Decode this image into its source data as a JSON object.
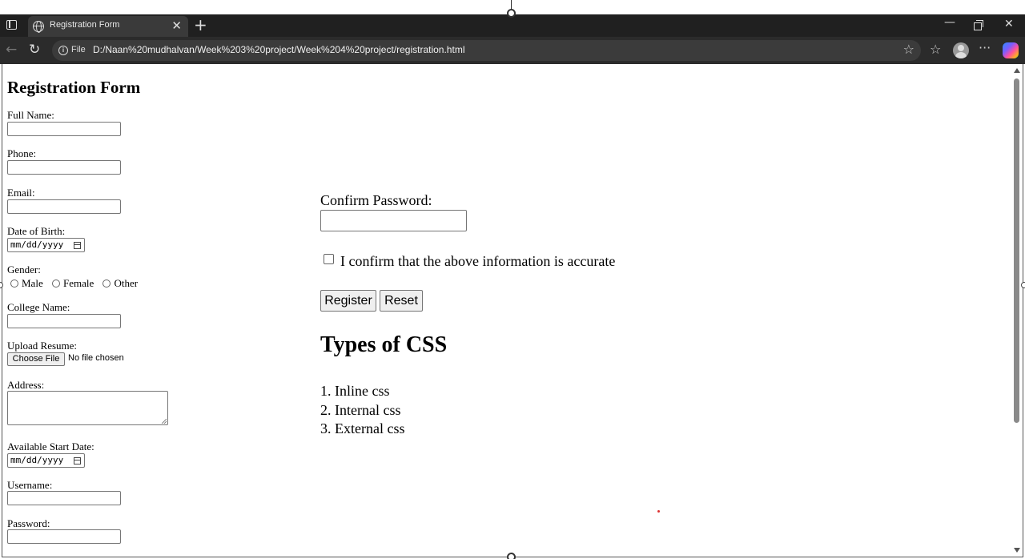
{
  "browser": {
    "tab_title": "Registration Form",
    "tab_close": "✕",
    "new_tab": "+",
    "url_scheme_label": "File",
    "url": "D:/Naan%20mudhalvan/Week%203%20project/Week%204%20project/registration.html",
    "window_minimize": "—",
    "window_close": "✕"
  },
  "page": {
    "title": "Registration Form",
    "fields": {
      "full_name_label": "Full Name:",
      "phone_label": "Phone:",
      "email_label": "Email:",
      "dob_label": "Date of Birth:",
      "dob_placeholder": "mm/dd/yyyy",
      "gender_label": "Gender:",
      "gender_options": [
        "Male",
        "Female",
        "Other"
      ],
      "college_label": "College Name:",
      "resume_label": "Upload Resume:",
      "resume_button": "Choose File",
      "resume_status": "No file chosen",
      "address_label": "Address:",
      "start_date_label": "Available Start Date:",
      "start_date_placeholder": "mm/dd/yyyy",
      "username_label": "Username:",
      "password_label": "Password:",
      "confirm_password_label": "Confirm Password:",
      "confirm_text": "I confirm that the above information is accurate"
    },
    "buttons": {
      "register": "Register",
      "reset": "Reset"
    },
    "css_section": {
      "heading": "Types of CSS",
      "items": [
        "1. Inline css",
        "2. Internal css",
        "3. External css"
      ]
    }
  }
}
